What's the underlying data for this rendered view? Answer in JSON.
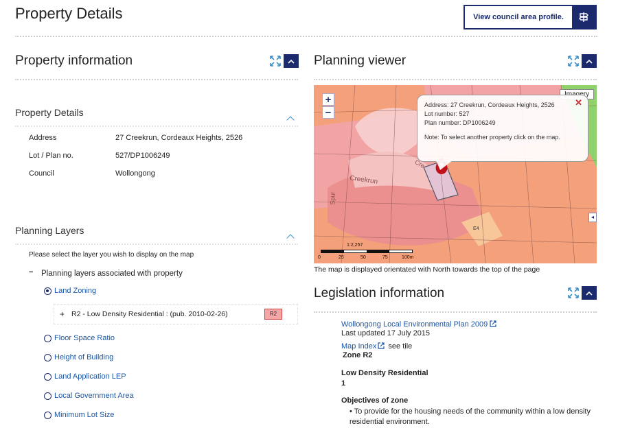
{
  "page": {
    "title": "Property Details",
    "profile_button": "View council area profile."
  },
  "property_info": {
    "heading": "Property information",
    "details_heading": "Property Details",
    "rows": [
      {
        "label": "Address",
        "value": "27 Creekrun, Cordeaux Heights, 2526"
      },
      {
        "label": "Lot / Plan no.",
        "value": "527/DP1006249"
      },
      {
        "label": "Council",
        "value": "Wollongong"
      }
    ],
    "layers_heading": "Planning Layers",
    "layers_instruction": "Please select the layer you wish to display on the map",
    "layers_group_toggle": "−",
    "layers_group_label": "Planning layers associated with property",
    "layers": [
      {
        "label": "Land Zoning",
        "selected": true
      },
      {
        "label": "Floor Space Ratio",
        "selected": false
      },
      {
        "label": "Height of Building",
        "selected": false
      },
      {
        "label": "Land Application LEP",
        "selected": false
      },
      {
        "label": "Local Government Area",
        "selected": false
      },
      {
        "label": "Minimum Lot Size",
        "selected": false
      }
    ],
    "zoning_legend": {
      "toggle": "+",
      "label": "R2 - Low Density Residential : (pub. 2010-02-26)",
      "code": "R2",
      "color": "#f5a7a7"
    }
  },
  "planning_viewer": {
    "heading": "Planning viewer",
    "imagery_button": "Imagery",
    "zoom_in": "+",
    "zoom_out": "−",
    "popup": {
      "address": "Address: 27 Creekrun, Cordeaux Heights, 2526",
      "lot": "Lot number: 527",
      "plan": "Plan number: DP1006249",
      "note": "Note: To select another property click on the map.",
      "close": "✕"
    },
    "street_label": "Creekrun",
    "street_label_2": "Cre",
    "street_label_3": "Spur",
    "zone_label": "E4",
    "scale_ratio": "1:2,257",
    "scale_ticks": [
      "0",
      "25",
      "50",
      "75",
      "100m"
    ],
    "caption": "The map is displayed orientated with North towards the top of the page",
    "colors": {
      "r2": "#f2a3a3",
      "e4": "#f7c79a",
      "orange": "#f4a07a",
      "green": "#8fd16a"
    }
  },
  "legislation": {
    "heading": "Legislation information",
    "plan_link": "Wollongong Local Environmental Plan 2009",
    "last_updated": "Last updated 17 July 2015",
    "map_index_link": "Map Index",
    "map_index_suffix": " see tile",
    "zone": "Zone R2",
    "zone_name": "Low Density Residential",
    "zone_number": "1",
    "objectives_heading": "Objectives of zone",
    "objective_1": "• To provide for the housing needs of the community within a low density residential environment."
  },
  "colors": {
    "navy": "#1a2a6c",
    "link": "#1a56a6",
    "chevron": "#3a8fc8"
  }
}
